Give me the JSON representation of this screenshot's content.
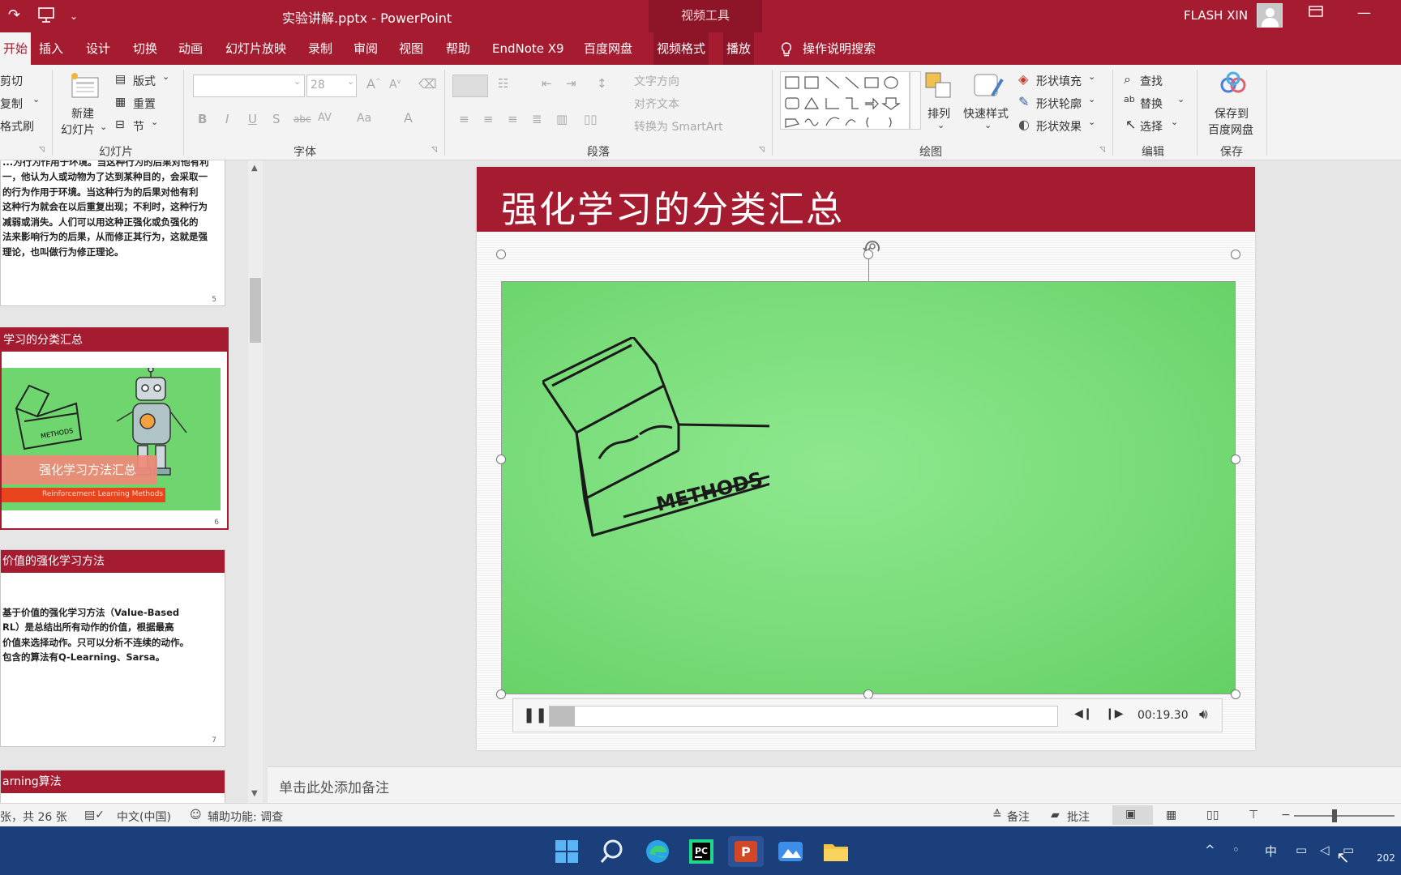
{
  "titlebar": {
    "doc_title": "实验讲解.pptx - PowerPoint",
    "context_tab_group": "视频工具",
    "user_name": "FLASH XIN"
  },
  "tabs": [
    "开始",
    "插入",
    "设计",
    "切换",
    "动画",
    "幻灯片放映",
    "录制",
    "审阅",
    "视图",
    "帮助",
    "EndNote X9",
    "百度网盘",
    "视频格式",
    "播放"
  ],
  "tell_me": "操作说明搜索",
  "ribbon": {
    "clipboard": {
      "cut": "剪切",
      "copy": "复制",
      "format_painter": "格式刷"
    },
    "slides": {
      "new_slide": "新建",
      "new_slide_2": "幻灯片",
      "layout": "版式",
      "reset": "重置",
      "section": "节",
      "group": "幻灯片"
    },
    "font": {
      "size_value": "28",
      "group": "字体"
    },
    "paragraph": {
      "text_direction": "文字方向",
      "align_text": "对齐文本",
      "convert_smartart": "转换为 SmartArt",
      "group": "段落"
    },
    "drawing": {
      "arrange": "排列",
      "quick_styles": "快速样式",
      "shape_fill": "形状填充",
      "shape_outline": "形状轮廓",
      "shape_effects": "形状效果",
      "group": "绘图"
    },
    "editing": {
      "find": "查找",
      "replace": "替换",
      "select": "选择",
      "group": "编辑"
    },
    "save": {
      "save_to_1": "保存到",
      "save_to_2": "百度网盘",
      "group": "保存"
    }
  },
  "thumbnails": {
    "slide5": {
      "lines": [
        "...为行为作用于环境。当这种行为的后果对他有利",
        "一，他认为人或动物为了达到某种目的，会采取一",
        "的行为作用于环境。当这种行为的后果对他有利",
        "这种行为就会在以后重复出现；不利时，这种行为",
        "减弱或消失。人们可以用这种正强化或负强化的",
        "法来影响行为的后果，从而修正其行为，这就是强",
        "理论，也叫做行为修正理论。"
      ],
      "number": "5"
    },
    "slide6": {
      "title": "学习的分类汇总",
      "box_label": "METHODS",
      "banner": "强化学习方法汇总",
      "subbanner": "Reinforcement Learning Methods",
      "number": "6"
    },
    "slide7": {
      "title": "价值的强化学习方法",
      "lines": [
        "基于价值的强化学习方法（Value-Based",
        "RL）是总结出所有动作的价值，根据最高",
        "价值来选择动作。只可以分析不连续的动作。",
        "包含的算法有Q-Learning、Sarsa。"
      ],
      "number": "7"
    },
    "slide8": {
      "title": "arning算法"
    }
  },
  "slide": {
    "title": "强化学习的分类汇总",
    "video_box_label": "METHODS",
    "player": {
      "time": "00:19.30",
      "progress": 0.05
    }
  },
  "notes_placeholder": "单击此处添加备注",
  "status": {
    "slide_count": "张，共 26 张",
    "language": "中文(中国)",
    "accessibility": "辅助功能: 调查",
    "notes": "备注",
    "comments": "批注"
  },
  "taskbar": {
    "ime": "中",
    "clock_partial": "202"
  },
  "colors": {
    "accent": "#a51c30",
    "video_bg": "#79dc79",
    "taskbar": "#1a3f7a"
  }
}
